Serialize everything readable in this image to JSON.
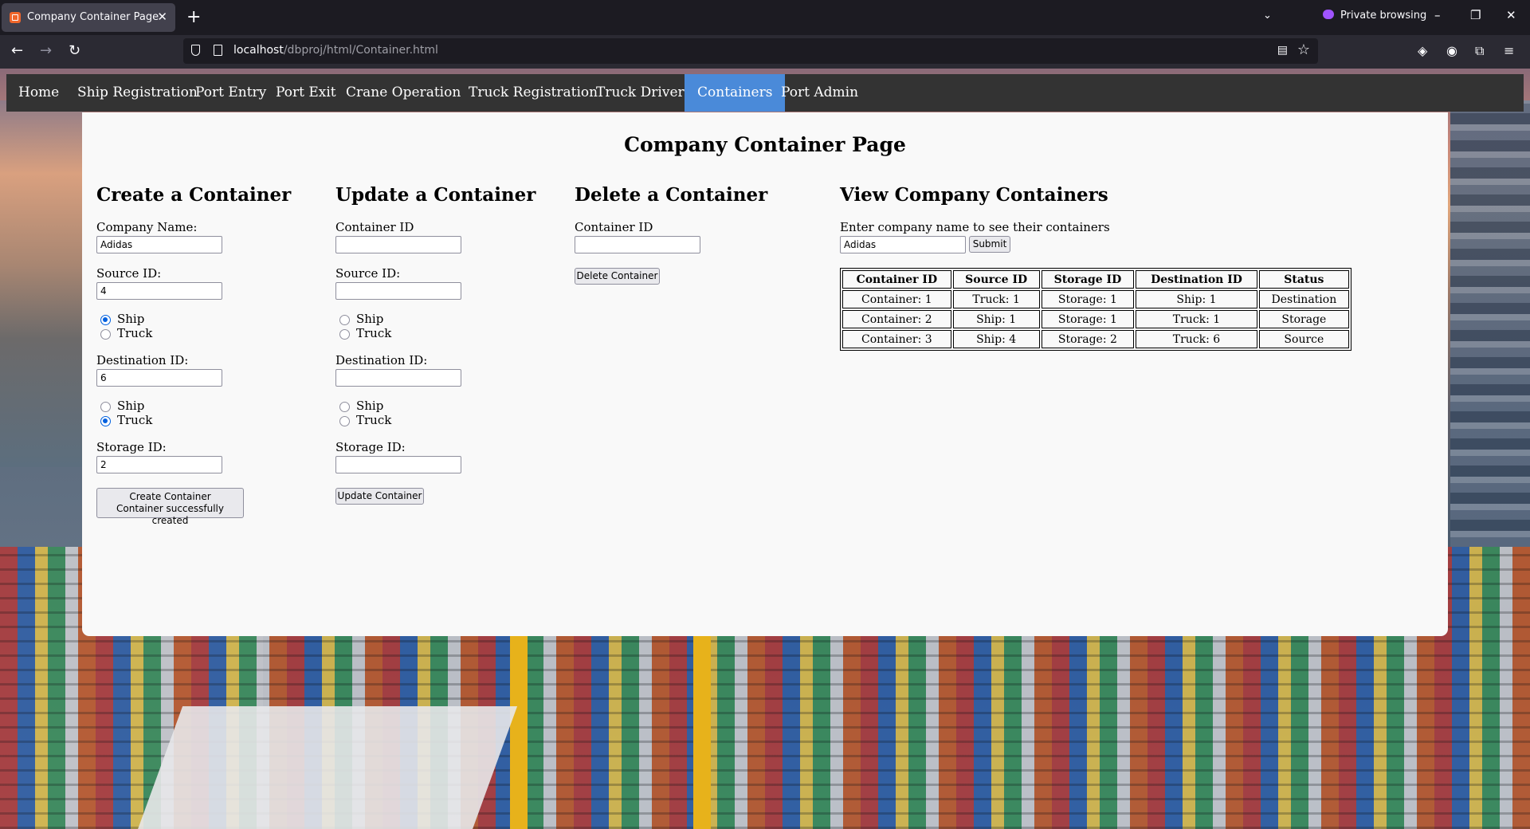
{
  "browser": {
    "tab_title": "Company Container Page",
    "tab_close": "✕",
    "new_tab": "+",
    "private_label": "Private browsing",
    "url_host": "localhost",
    "url_path": "/dbproj/html/Container.html"
  },
  "site_nav": {
    "items": [
      "Home",
      "Ship Registration",
      "Port Entry",
      "Port Exit",
      "Crane Operation",
      "Truck Registration",
      "Truck Drivers",
      "Containers",
      "Port Admin"
    ],
    "active": "Containers"
  },
  "page": {
    "title": "Company Container Page"
  },
  "create": {
    "heading": "Create a Container",
    "company_label": "Company Name:",
    "company_value": "Adidas",
    "source_label": "Source ID:",
    "source_value": "4",
    "source_type_options": [
      "Ship",
      "Truck"
    ],
    "source_type_selected": "Ship",
    "destination_label": "Destination ID:",
    "destination_value": "6",
    "destination_type_options": [
      "Ship",
      "Truck"
    ],
    "destination_type_selected": "Truck",
    "storage_label": "Storage ID:",
    "storage_value": "2",
    "button_label": "Create Container",
    "button_status": "Container successfully created"
  },
  "update": {
    "heading": "Update a Container",
    "container_label": "Container ID",
    "container_value": "",
    "source_label": "Source ID:",
    "source_value": "",
    "source_type_options": [
      "Ship",
      "Truck"
    ],
    "destination_label": "Destination ID:",
    "destination_value": "",
    "destination_type_options": [
      "Ship",
      "Truck"
    ],
    "storage_label": "Storage ID:",
    "storage_value": "",
    "button_label": "Update Container"
  },
  "delete": {
    "heading": "Delete a Container",
    "container_label": "Container ID",
    "container_value": "",
    "button_label": "Delete Container"
  },
  "view": {
    "heading": "View Company Containers",
    "prompt": "Enter company name to see their containers",
    "company_value": "Adidas",
    "submit_label": "Submit",
    "columns": [
      "Container ID",
      "Source ID",
      "Storage ID",
      "Destination ID",
      "Status"
    ],
    "rows": [
      [
        "Container: 1",
        "Truck: 1",
        "Storage: 1",
        "Ship: 1",
        "Destination"
      ],
      [
        "Container: 2",
        "Ship: 1",
        "Storage: 1",
        "Truck: 1",
        "Storage"
      ],
      [
        "Container: 3",
        "Ship: 4",
        "Storage: 2",
        "Truck: 6",
        "Source"
      ]
    ]
  }
}
